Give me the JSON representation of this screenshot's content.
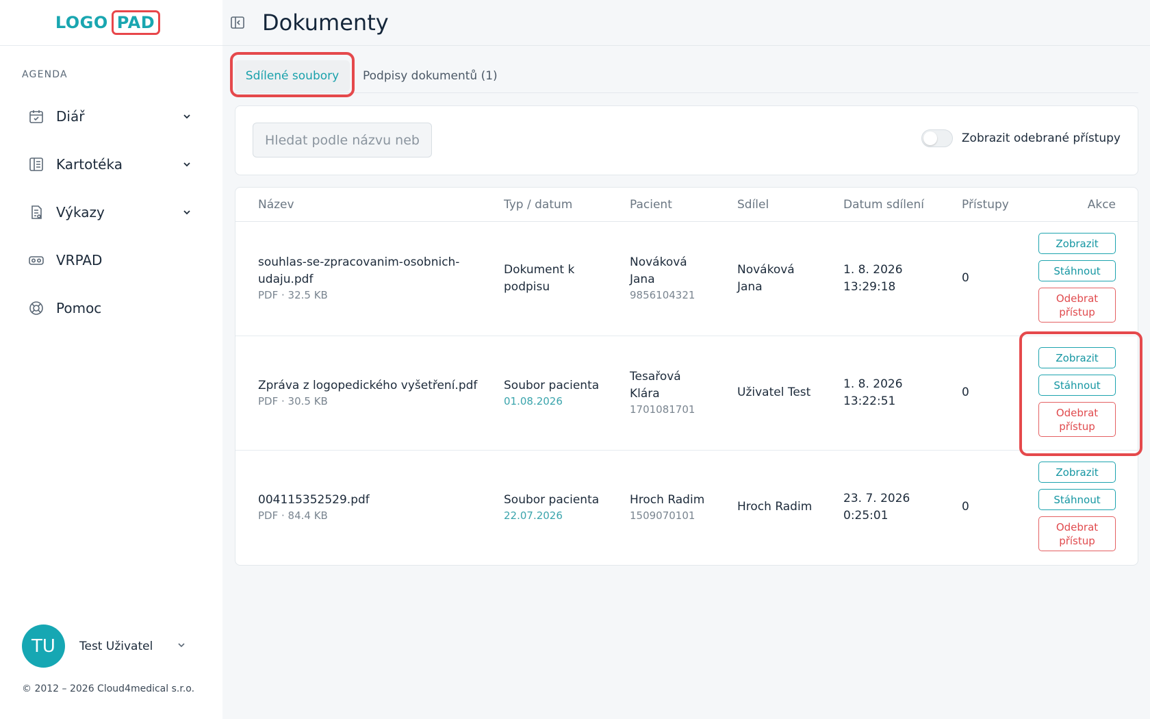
{
  "logo": {
    "part1": "LOGO",
    "part2": "PAD"
  },
  "sidebar": {
    "section_label": "AGENDA",
    "items": [
      {
        "label": "Diář",
        "icon": "calendar-icon",
        "has_chevron": true
      },
      {
        "label": "Kartotéka",
        "icon": "book-icon",
        "has_chevron": true
      },
      {
        "label": "Výkazy",
        "icon": "report-icon",
        "has_chevron": true
      },
      {
        "label": "VRPAD",
        "icon": "vr-headset-icon",
        "has_chevron": false
      },
      {
        "label": "Pomoc",
        "icon": "lifebuoy-icon",
        "has_chevron": false
      }
    ],
    "user": {
      "initials": "TU",
      "name": "Test Uživatel"
    },
    "footer": "© 2012 – 2026 Cloud4medical s.r.o."
  },
  "header": {
    "title": "Dokumenty"
  },
  "tabs": [
    {
      "label": "Sdílené soubory",
      "active": true
    },
    {
      "label": "Podpisy dokumentů (1)",
      "active": false
    }
  ],
  "filter": {
    "search_placeholder": "Hledat podle názvu nebo",
    "toggle_label": "Zobrazit odebrané přístupy",
    "toggle_on": false
  },
  "table": {
    "columns": [
      "Název",
      "Typ / datum",
      "Pacient",
      "Sdílel",
      "Datum sdílení",
      "Přístupy",
      "Akce"
    ],
    "rows": [
      {
        "name_line1": "souhlas-se-zpracovanim-osobnich-",
        "name_line2": "udaju.pdf",
        "name_meta": "PDF · 32.5 KB",
        "type_line1": "Dokument k",
        "type_line2": "podpisu",
        "type_date": "",
        "patient_line1": "Nováková",
        "patient_line2": "Jana",
        "patient_id": "9856104321",
        "shared_by_line1": "Nováková",
        "shared_by_line2": "Jana",
        "date_line1": "1. 8. 2026",
        "date_line2": "13:29:18",
        "access": "0"
      },
      {
        "name_line1": "Zpráva z logopedického vyšetření.pdf",
        "name_line2": "",
        "name_meta": "PDF · 30.5 KB",
        "type_line1": "Soubor pacienta",
        "type_line2": "",
        "type_date": "01.08.2026",
        "patient_line1": "Tesařová",
        "patient_line2": "Klára",
        "patient_id": "1701081701",
        "shared_by_line1": "Uživatel Test",
        "shared_by_line2": "",
        "date_line1": "1. 8. 2026",
        "date_line2": "13:22:51",
        "access": "0"
      },
      {
        "name_line1": "004115352529.pdf",
        "name_line2": "",
        "name_meta": "PDF · 84.4 KB",
        "type_line1": "Soubor pacienta",
        "type_line2": "",
        "type_date": "22.07.2026",
        "patient_line1": "Hroch Radim",
        "patient_line2": "",
        "patient_id": "1509070101",
        "shared_by_line1": "Hroch Radim",
        "shared_by_line2": "",
        "date_line1": "23. 7. 2026",
        "date_line2": "0:25:01",
        "access": "0"
      }
    ],
    "actions": {
      "view": "Zobrazit",
      "download": "Stáhnout",
      "revoke": "Odebrat přístup"
    }
  },
  "colors": {
    "accent": "#19a6b0",
    "danger": "#e5494c",
    "text": "#1c2a3a"
  }
}
